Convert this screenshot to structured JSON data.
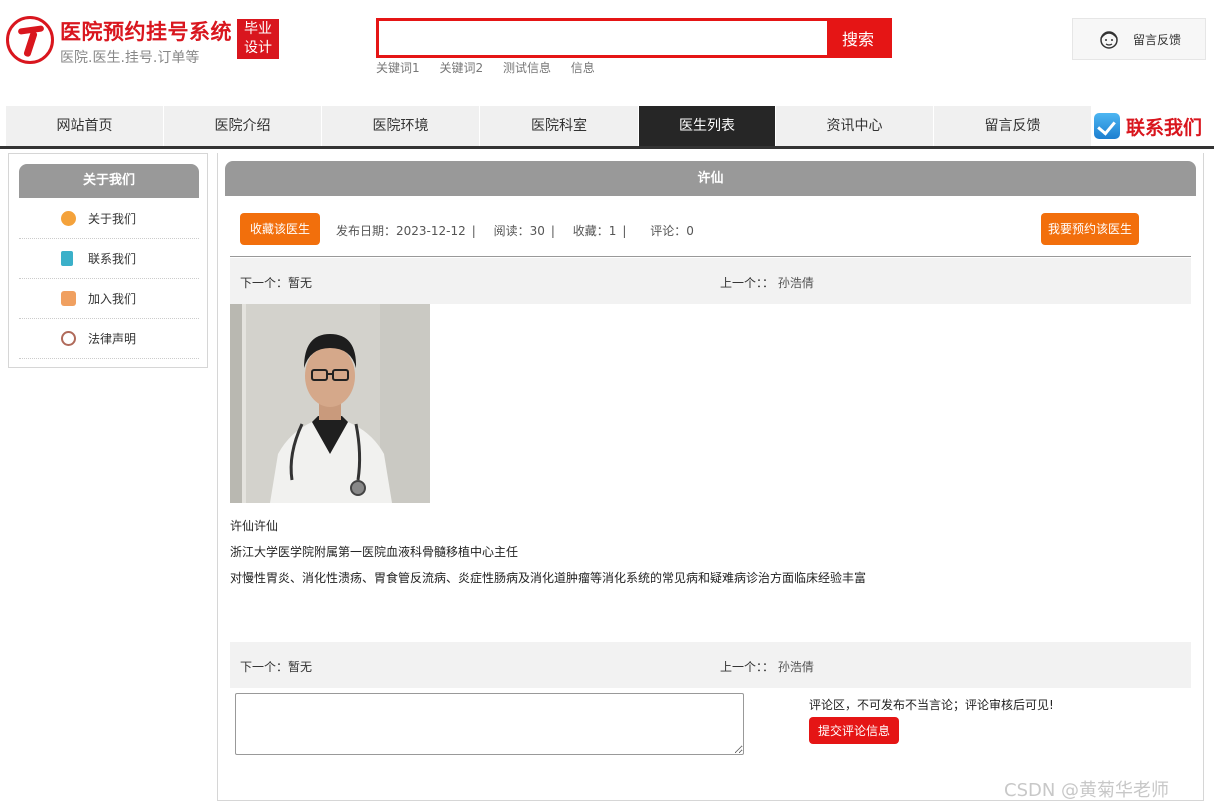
{
  "header": {
    "title": "医院预约挂号系统",
    "subtitle": "医院.医生.挂号.订单等",
    "badge_line1": "毕业",
    "badge_line2": "设计",
    "search_button": "搜索",
    "search_value": "",
    "keywords": [
      "关键词1",
      "关键词2",
      "测试信息",
      "信息"
    ],
    "feedback_label": "留言反馈"
  },
  "nav": {
    "items": [
      "网站首页",
      "医院介绍",
      "医院环境",
      "医院科室",
      "医生列表",
      "资讯中心",
      "留言反馈"
    ],
    "active": "医生列表",
    "contact": "联系我们"
  },
  "sidebar": {
    "title": "关于我们",
    "items": [
      {
        "label": "关于我们",
        "icon": "info-icon",
        "color": "#f4a23b"
      },
      {
        "label": "联系我们",
        "icon": "clipboard-icon",
        "color": "#3bb0c9"
      },
      {
        "label": "加入我们",
        "icon": "lock-icon",
        "color": "#f0a060"
      },
      {
        "label": "法律声明",
        "icon": "power-icon",
        "color": "#b06a5a"
      }
    ]
  },
  "article": {
    "title": "许仙",
    "favorite_button": "收藏该医生",
    "book_button": "我要预约该医生",
    "publish": "发布日期：2023-12-12",
    "reads": "阅读：30",
    "favorites": "收藏：1",
    "comments": "评论：0",
    "sep": "|",
    "next": "下一个：暂无",
    "prev_label": "上一个：：",
    "prev_name": "孙浩倩",
    "name_line": "许仙许仙",
    "position_line": "浙江大学医学院附属第一医院血液科骨髓移植中心主任",
    "expertise_line": "对慢性胃炎、消化性溃疡、胃食管反流病、炎症性肠病及消化道肿瘤等消化系统的常见病和疑难病诊治方面临床经验丰富"
  },
  "comment": {
    "value": "",
    "note": "评论区，不可发布不当言论；评论审核后可见!",
    "submit": "提交评论信息"
  },
  "watermark": "CSDN @黄菊华老师",
  "colors": {
    "brand_red": "#d9161e",
    "search_red": "#e51515",
    "orange": "#f26f0c",
    "nav_active": "#262626",
    "header_gray": "#999999"
  }
}
